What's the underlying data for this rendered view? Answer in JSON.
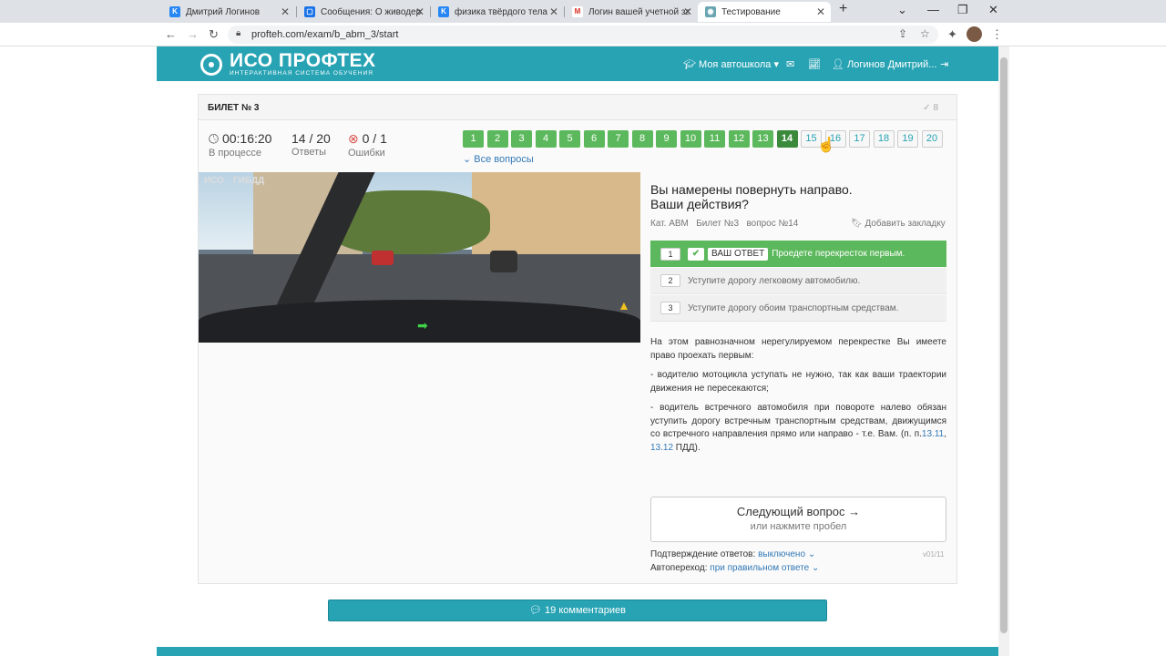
{
  "browser": {
    "tabs": [
      {
        "title": "Дмитрий Логинов",
        "icon": "vk-icon"
      },
      {
        "title": "Сообщения: О живодерах",
        "icon": "messages-icon"
      },
      {
        "title": "физика твёрдого тела",
        "icon": "vk-icon"
      },
      {
        "title": "Логин вашей учетной за",
        "icon": "gmail-icon"
      },
      {
        "title": "Тестирование",
        "icon": "site-icon"
      }
    ],
    "url": "profteh.com/exam/b_abm_3/start"
  },
  "header": {
    "logo_title": "ИСО ПРОФТЕХ",
    "logo_subtitle": "ИНТЕРАКТИВНАЯ СИСТЕМА ОБУЧЕНИЯ",
    "school_menu": "Моя автошкола",
    "user_name": "Логинов Дмитрий..."
  },
  "ticket": {
    "title": "БИЛЕТ № 3",
    "check_count": "8",
    "timer": "00:16:20",
    "timer_label": "В процессе",
    "answers": "14 / 20",
    "answers_label": "Ответы",
    "errors": "0 / 1",
    "errors_label": "Ошибки",
    "question_numbers": [
      "1",
      "2",
      "3",
      "4",
      "5",
      "6",
      "7",
      "8",
      "9",
      "10",
      "11",
      "12",
      "13",
      "14",
      "15",
      "16",
      "17",
      "18",
      "19",
      "20"
    ],
    "current_question": 14,
    "all_questions_label": "Все вопросы"
  },
  "image": {
    "label_left": "ИСО",
    "label_right": "ГИБДД"
  },
  "question": {
    "text": "Вы намерены повернуть направо. Ваши действия?",
    "category": "Кат. ABM",
    "ticket_ref": "Билет №3",
    "question_ref": "вопрос №14",
    "bookmark_label": "Добавить закладку",
    "your_answer_label": "ВАШ ОТВЕТ",
    "options": [
      {
        "num": "1",
        "text": "Проедете перекресток первым."
      },
      {
        "num": "2",
        "text": "Уступите дорогу легковому автомобилю."
      },
      {
        "num": "3",
        "text": "Уступите дорогу обоим транспортным средствам."
      }
    ]
  },
  "explanation": {
    "p1": "На этом равнозначном нерегулируемом перекрестке Вы имеете право проехать первым:",
    "p2": "- водителю мотоцикла уступать не нужно, так как ваши траектории движения не пересекаются;",
    "p3_a": "- водитель встречного автомобиля при повороте налево обязан уступить дорогу встречным транспортным средствам, движущимся со встречного направления прямо или направо - т.е. Вам.  (п. п.",
    "link1": "13.11",
    "sep": ", ",
    "link2": "13.12",
    "p3_b": " ПДД)."
  },
  "next": {
    "title": "Следующий вопрос →",
    "subtitle": "или нажмите пробел"
  },
  "settings": {
    "confirm_label": "Подтверждение ответов:",
    "confirm_value": "выключено",
    "auto_label": "Автопереход:",
    "auto_value": "при правильном ответе",
    "version": "v01/11"
  },
  "comments_label": "19 комментариев"
}
